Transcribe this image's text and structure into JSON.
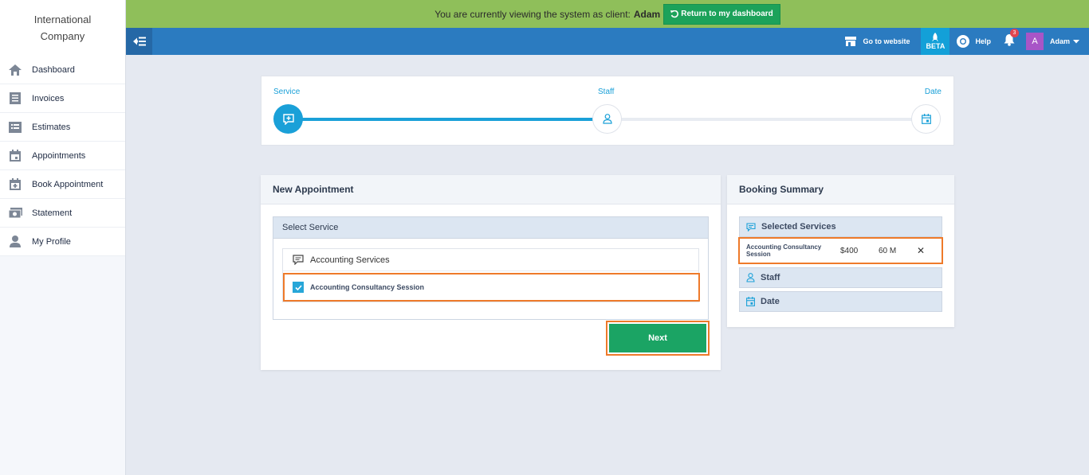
{
  "brand": {
    "name": "International Company"
  },
  "sidebar": {
    "items": [
      {
        "label": "Dashboard",
        "icon": "home-icon"
      },
      {
        "label": "Invoices",
        "icon": "invoice-icon"
      },
      {
        "label": "Estimates",
        "icon": "estimate-icon"
      },
      {
        "label": "Appointments",
        "icon": "calendar-icon"
      },
      {
        "label": "Book Appointment",
        "icon": "calendar-plus-icon"
      },
      {
        "label": "Statement",
        "icon": "money-icon"
      },
      {
        "label": "My Profile",
        "icon": "user-icon"
      }
    ]
  },
  "banner": {
    "text": "You are currently viewing the system as client:",
    "client": "Adam",
    "return_label": "Return to my dashboard"
  },
  "topbar": {
    "website_label": "Go to website",
    "beta_label": "BETA",
    "help_label": "Help",
    "notifications_count": "3",
    "avatar_letter": "A",
    "user_name": "Adam"
  },
  "stepper": {
    "steps": [
      {
        "label": "Service",
        "state": "active"
      },
      {
        "label": "Staff",
        "state": "pending"
      },
      {
        "label": "Date",
        "state": "pending"
      }
    ],
    "progress_fraction": 0.5
  },
  "new_appointment": {
    "title": "New Appointment",
    "select_service_label": "Select Service",
    "group_name": "Accounting Services",
    "service_name": "Accounting Consultancy Session",
    "service_checked": true,
    "next_label": "Next"
  },
  "booking_summary": {
    "title": "Booking Summary",
    "selected_services_label": "Selected Services",
    "item": {
      "name": "Accounting Consultancy Session",
      "price": "$400",
      "duration": "60 M",
      "remove": "✕"
    },
    "staff_label": "Staff",
    "date_label": "Date"
  },
  "colors": {
    "banner": "#8fbf5a",
    "topbar": "#2b7bc0",
    "accent": "#1aa0d8",
    "next_button": "#1ba464",
    "highlight": "#ee7a2a"
  }
}
